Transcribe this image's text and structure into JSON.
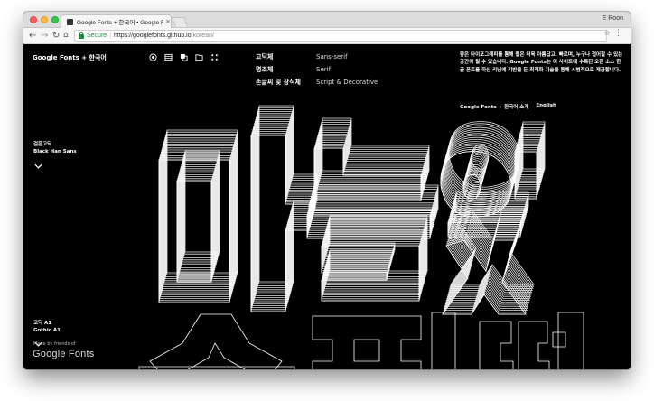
{
  "browser": {
    "tab_title": "Google Fonts + 한국어 • Google Fonts",
    "tab_close": "×",
    "profile": "E Roon",
    "secure_label": "Secure",
    "url_sep": "|",
    "url_host": "https://googlefonts.github.io",
    "url_path": "/korean/",
    "back": "←",
    "forward": "→",
    "reload": "↻",
    "home": "⌂",
    "star": "☆",
    "menu": "⋮"
  },
  "page": {
    "brand": "Google Fonts + 한국어",
    "nav": [
      {
        "ko": "고딕체",
        "en": "Sans-serif"
      },
      {
        "ko": "명조체",
        "en": "Serif"
      },
      {
        "ko": "손글씨 및 장식체",
        "en": "Script & Decorative"
      }
    ],
    "about_text": "좋은 타이포그래피를 통해 웹은 더욱 아름답고, 빠르며, 누구나 접어할 수 있는 공간이 될 수 있습니다. Google Fonts는 이 사이트에 수록된 오픈 소스 한글 폰트를 하신 리님에 기반을 둔 최적화 기술을 통해 시범적으로 제공합니다.",
    "about_link": "Google Fonts + 한국어 소개",
    "lang_link": "English",
    "font1": {
      "ko": "검은고딕",
      "en": "Black Han Sans"
    },
    "font2": {
      "ko": "고딕 A1",
      "en": "Gothic A1"
    },
    "made_by": "Made by friends of",
    "logo": "Google Fonts",
    "icons": [
      "target-icon",
      "stack-icon",
      "copy-icon",
      "window-icon",
      "grid-icon"
    ]
  },
  "colors": {
    "page_bg": "#000000",
    "text": "#ffffff",
    "secure": "#1a8b3c"
  }
}
